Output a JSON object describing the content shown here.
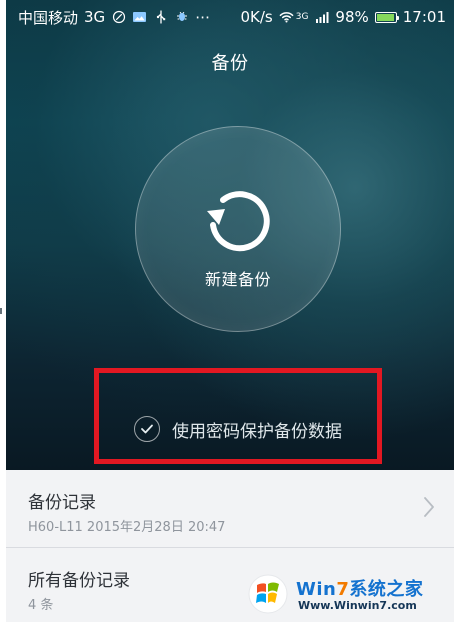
{
  "status_bar": {
    "carrier": "中国移动",
    "network": "3G",
    "speed": "0K/s",
    "signal_label": "3G",
    "battery_percent": "98%",
    "time": "17:01"
  },
  "page": {
    "title": "备份"
  },
  "backup": {
    "new_backup_label": "新建备份"
  },
  "protection": {
    "label": "使用密码保护备份数据"
  },
  "list": {
    "items": [
      {
        "title": "备份记录",
        "subtitle": "H60-L11  2015年2月28日 20:47"
      },
      {
        "title": "所有备份记录",
        "subtitle": "4 条"
      }
    ]
  },
  "watermark": {
    "brand_prefix": "Win",
    "brand_number": "7",
    "brand_suffix": "系统之家",
    "site": "Www.Winwin7.com"
  },
  "colors": {
    "highlight": "#e21822",
    "battery_fill": "#86d95c",
    "brand_blue": "#1472cf",
    "brand_orange": "#f27a00"
  },
  "icons": {
    "status_1": "settings-outline-icon",
    "status_2": "image-icon",
    "status_3": "usb-icon",
    "status_4": "bug-icon",
    "status_5": "more-icon",
    "wifi": "wifi-icon",
    "signal": "signal-bars-icon",
    "battery": "battery-icon",
    "backup": "backup-refresh-icon",
    "check": "check-icon",
    "chevron": "chevron-right-icon",
    "logo": "windows-logo-icon"
  }
}
